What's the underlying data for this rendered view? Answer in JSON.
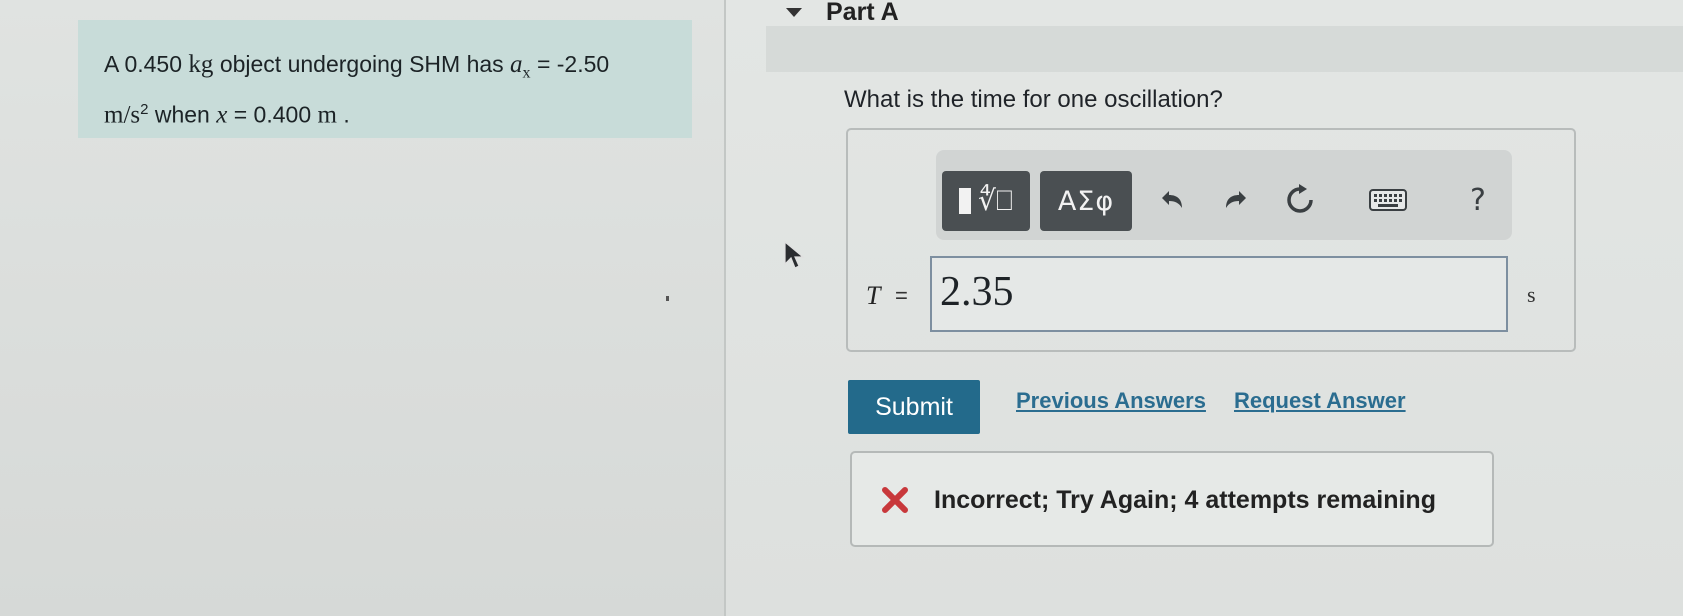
{
  "problem": {
    "text_1": "A 0.450",
    "unit_kg": "kg",
    "text_2": "object undergoing SHM has",
    "var_a": "a",
    "sub_x": "x",
    "text_3": "= -2.50",
    "unit_ms": "m/s",
    "sup_2": "2",
    "text_4": "when",
    "var_x": "x",
    "text_5": "= 0.400",
    "unit_m": "m",
    "text_6": "."
  },
  "part": {
    "title": "Part A",
    "question": "What is the time for one oscillation?"
  },
  "toolbar": {
    "templates_icon": "template-sqrt-icon",
    "greek_label": "ΑΣφ",
    "undo_icon": "undo-icon",
    "redo_icon": "redo-icon",
    "reset_icon": "reset-icon",
    "keyboard_icon": "keyboard-icon",
    "help_label": "?"
  },
  "answer": {
    "variable": "T",
    "equals": "=",
    "value": "2.35",
    "unit": "s"
  },
  "actions": {
    "submit_label": "Submit",
    "previous_answers_label": "Previous Answers",
    "request_answer_label": "Request Answer"
  },
  "feedback": {
    "message": "Incorrect; Try Again; 4 attempts remaining",
    "status_color": "#c8383b"
  },
  "colors": {
    "accent": "#236a8b",
    "link": "#2b6d90",
    "problem_bg": "#c8dcd9"
  }
}
